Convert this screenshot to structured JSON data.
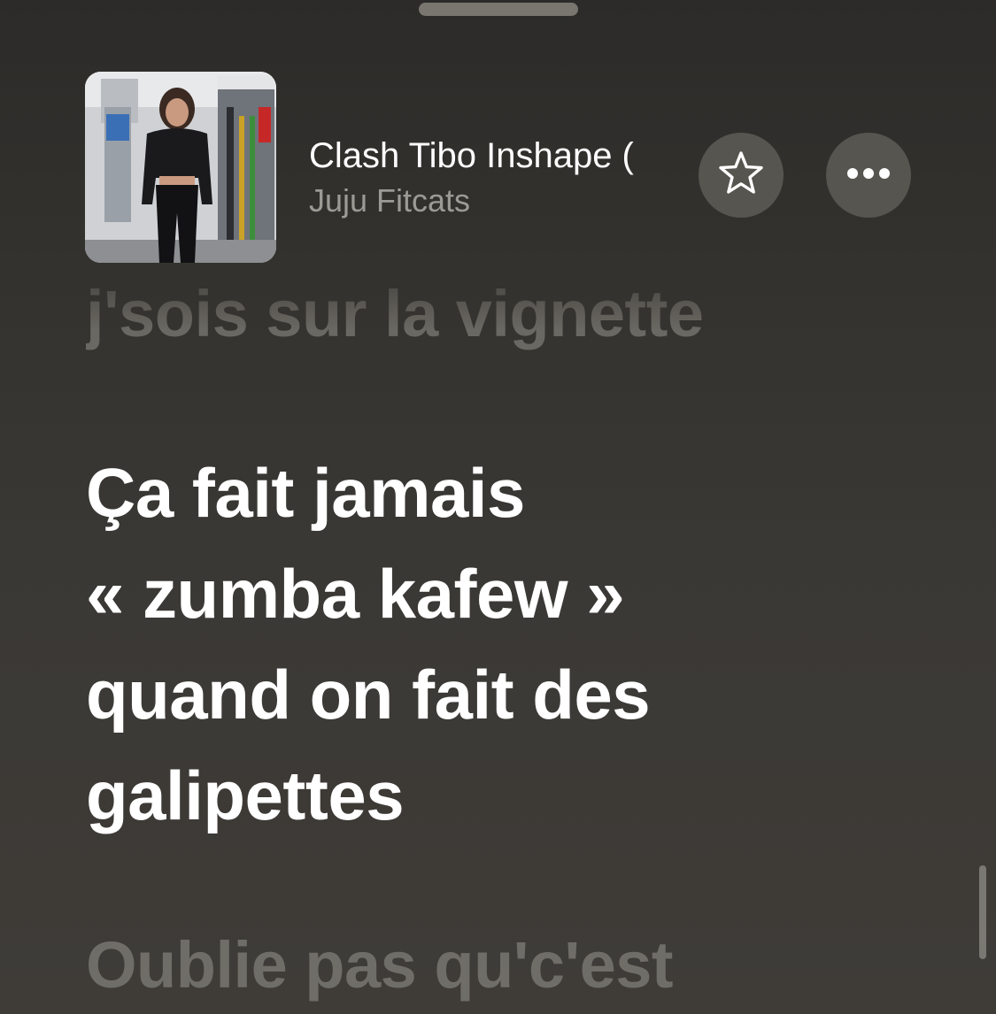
{
  "track": {
    "title": "Clash Tibo Inshape (",
    "artist": "Juju Fitcats"
  },
  "artwork": {
    "description_icon": "album-artwork"
  },
  "buttons": {
    "favorite_icon": "star-icon",
    "more_icon": "ellipsis-icon"
  },
  "lyrics": {
    "previous": "j'sois sur la vignette",
    "current_lines": [
      "Ça fait jamais",
      "« zumba kafew »",
      "quand on fait des",
      "galipettes"
    ],
    "next": "Oublie pas qu'c'est"
  },
  "colors": {
    "background": "#363430",
    "button_bg": "#57554f",
    "artist_text": "#9c9a94",
    "inactive_lyric": "#6a6862"
  }
}
